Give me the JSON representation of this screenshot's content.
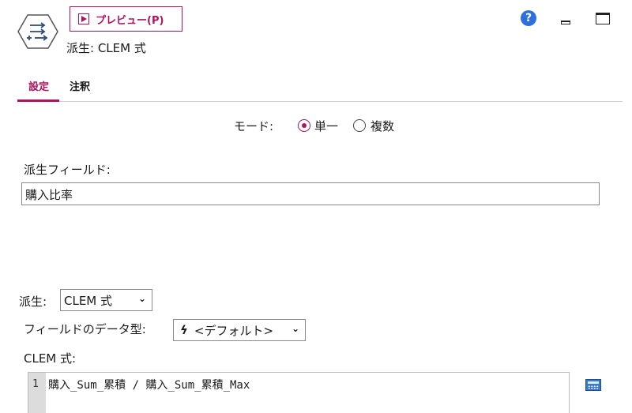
{
  "header": {
    "preview_label": "プレビュー(P)",
    "node_title": "派生: CLEM 式",
    "help_glyph": "?"
  },
  "tabs": [
    {
      "label": "設定",
      "active": true
    },
    {
      "label": "注釈",
      "active": false
    }
  ],
  "mode": {
    "label": "モード:",
    "options": [
      {
        "label": "単一",
        "checked": true
      },
      {
        "label": "複数",
        "checked": false
      }
    ]
  },
  "derive_field": {
    "label": "派生フィールド:",
    "value": "購入比率"
  },
  "derive_as": {
    "label": "派生:",
    "selected": "CLEM 式"
  },
  "field_type": {
    "label": "フィールドのデータ型:",
    "selected": "<デフォルト>"
  },
  "clem": {
    "label": "CLEM 式:",
    "line_number": "1",
    "expression": "購入_Sum_累積 / 購入_Sum_累積_Max"
  },
  "colors": {
    "accent": "#b0135e",
    "help": "#2d6fdc"
  },
  "icons": [
    "derive-node-icon",
    "play-icon",
    "help-icon",
    "minimize-icon",
    "maximize-icon",
    "chevron-down-icon",
    "lightning-icon",
    "expression-builder-icon"
  ]
}
